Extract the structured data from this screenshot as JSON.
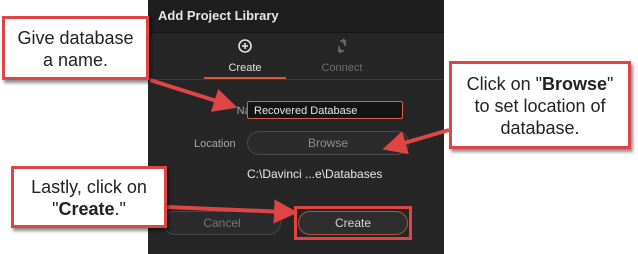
{
  "dialog": {
    "title": "Add Project Library",
    "tabs": [
      {
        "label": "Create",
        "icon": "plus-circle-icon"
      },
      {
        "label": "Connect",
        "icon": "connect-arrows-icon"
      }
    ],
    "name_label": "Name",
    "name_value": "Recovered Database",
    "location_label": "Location",
    "browse_label": "Browse",
    "path_text": "C:\\Davinci ...e\\Databases",
    "cancel_label": "Cancel",
    "create_label": "Create",
    "accent_color": "#e0543a"
  },
  "annotations": {
    "callout1": {
      "line1": "Give database",
      "line2": "a name."
    },
    "callout2": {
      "pre": "Click on \"",
      "bold": "Browse",
      "post": "\"",
      "line2": "to set location of",
      "line3": "database."
    },
    "callout3": {
      "line1": "Lastly, click on",
      "pre": "\"",
      "bold": "Create",
      "post": ".\""
    },
    "color": "#e04545"
  }
}
